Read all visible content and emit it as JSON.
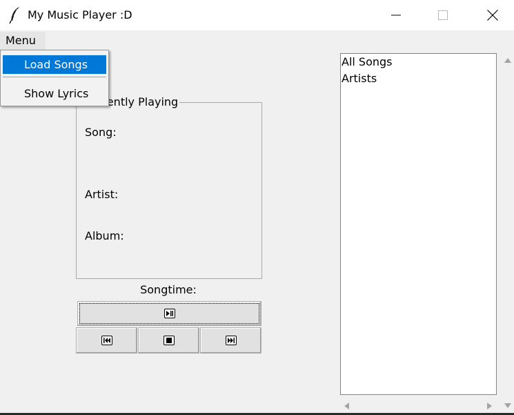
{
  "window": {
    "title": "My Music Player :D",
    "icon": "feather-icon",
    "controls": [
      "minimize-icon",
      "maximize-icon",
      "close-icon"
    ]
  },
  "menubar": {
    "menu_label": "Menu"
  },
  "dropdown": {
    "items": [
      {
        "label": "Load Songs",
        "selected": true
      },
      {
        "label": "Show Lyrics",
        "selected": false
      }
    ]
  },
  "now_playing": {
    "frame_label": "Currently Playing",
    "song_label": "Song:",
    "artist_label": "Artist:",
    "album_label": "Album:"
  },
  "songtime_label": "Songtime:",
  "controls": {
    "play_pause_icon": "play-pause-icon",
    "previous_icon": "previous-track-icon",
    "stop_icon": "stop-icon",
    "next_icon": "next-track-icon"
  },
  "library": {
    "items": [
      "All Songs",
      "Artists"
    ]
  },
  "colors": {
    "selection": "#0078d7",
    "window_bg": "#f0f0f0",
    "titlebar_bg": "#ffffff"
  }
}
